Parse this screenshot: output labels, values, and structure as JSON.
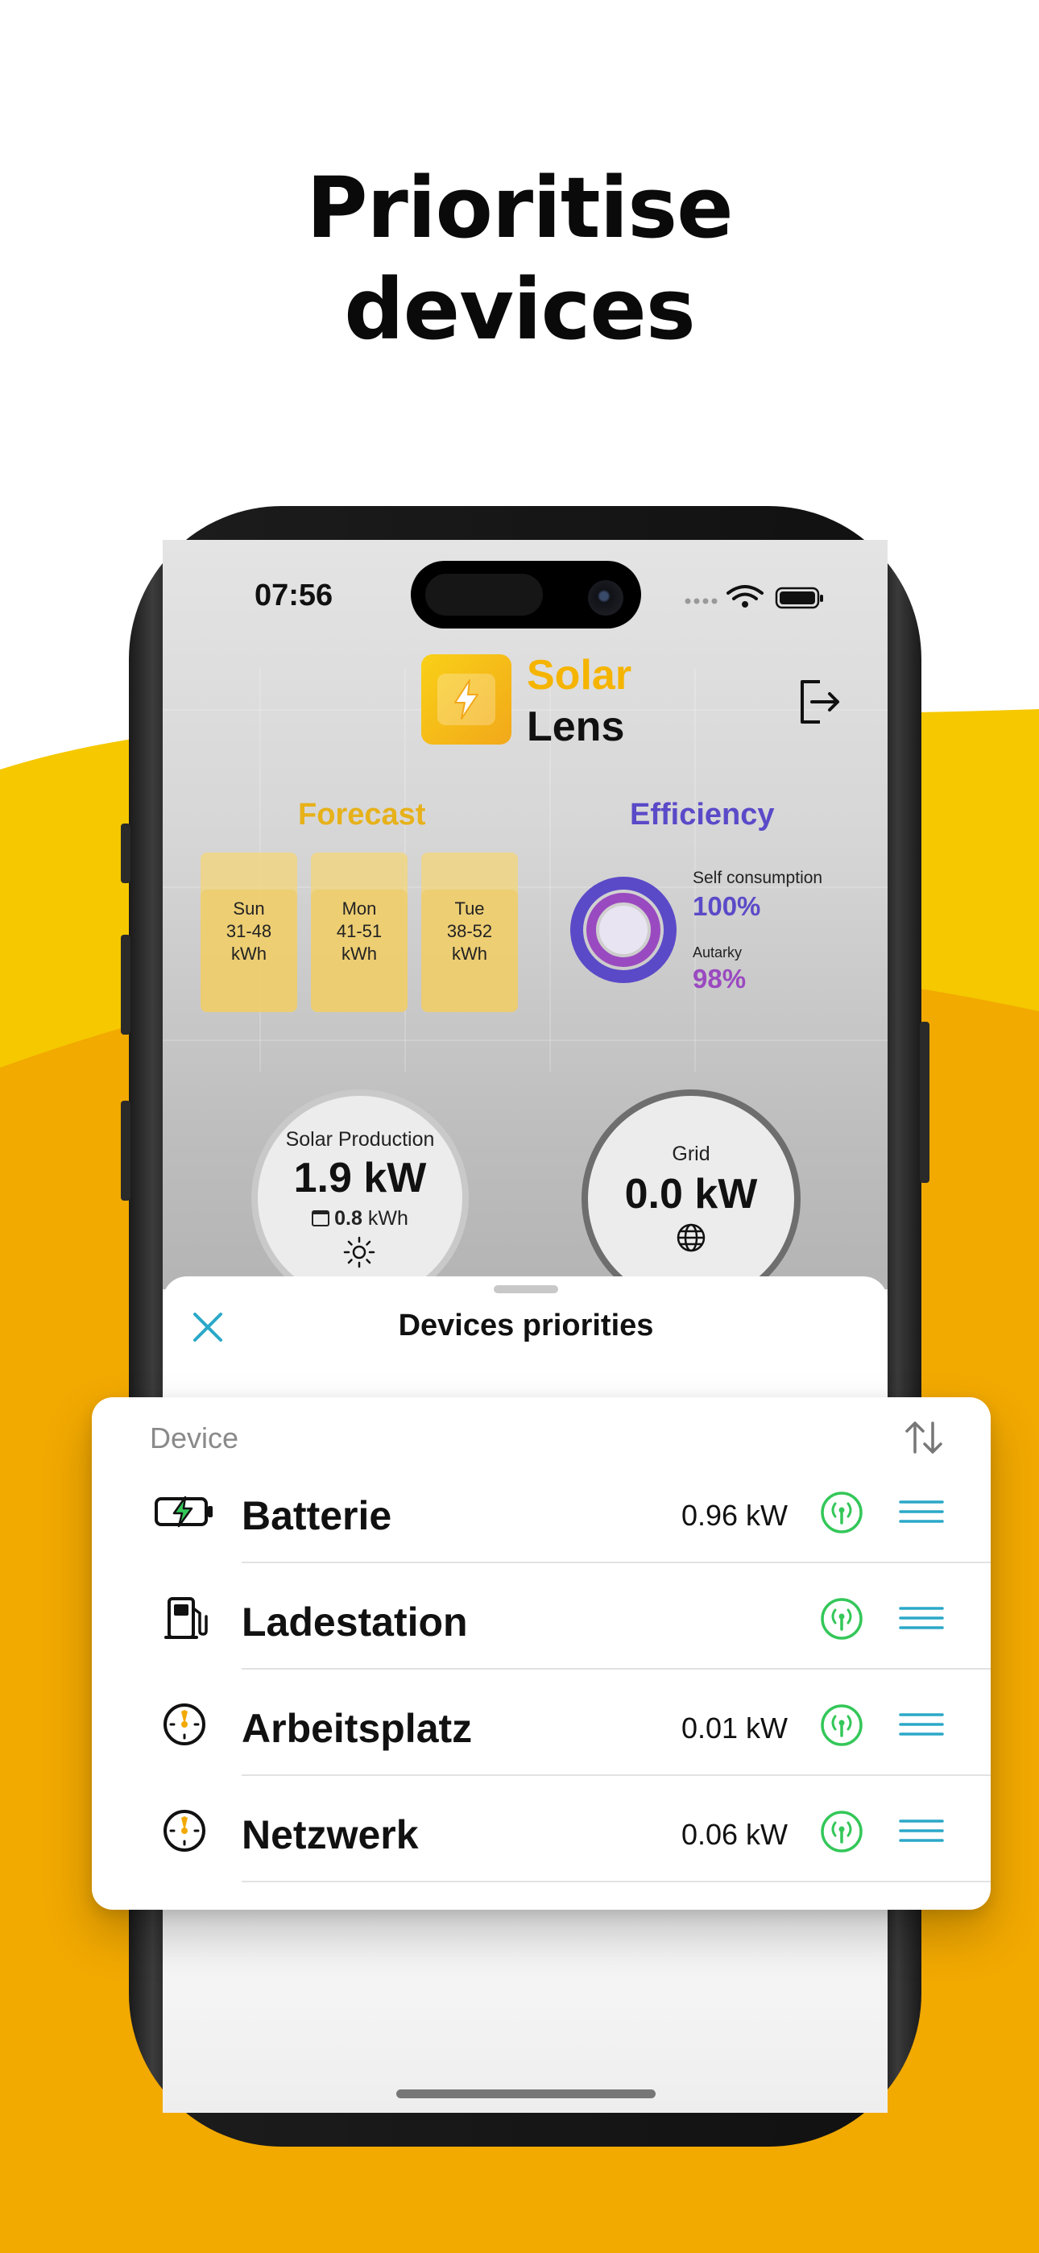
{
  "headline": {
    "line1": "Prioritise",
    "line2": "devices"
  },
  "colors": {
    "accent_yellow": "#F5C400",
    "accent_orange": "#F2A900",
    "green": "#34C759",
    "teal": "#2BA8C8",
    "purple": "#8A4AC8",
    "indigo": "#5A4AC8"
  },
  "status_bar": {
    "time": "07:56"
  },
  "app": {
    "title_line1": "Solar",
    "title_line2": "Lens",
    "logout_icon": "logout-icon"
  },
  "forecast": {
    "title": "Forecast",
    "days": [
      {
        "day": "Sun",
        "range": "31-48",
        "unit": "kWh"
      },
      {
        "day": "Mon",
        "range": "41-51",
        "unit": "kWh"
      },
      {
        "day": "Tue",
        "range": "38-52",
        "unit": "kWh"
      }
    ]
  },
  "efficiency": {
    "title": "Efficiency",
    "self_consumption_label": "Self consumption",
    "self_consumption_value": "100%",
    "autarky_label": "Autarky",
    "autarky_value": "98%"
  },
  "solar": {
    "label": "Solar Production",
    "value": "1.9 kW",
    "energy_value": "0.8",
    "energy_unit": "kWh"
  },
  "grid": {
    "label": "Grid",
    "value": "0.0 kW"
  },
  "sheet": {
    "title": "Devices priorities"
  },
  "table": {
    "column_device": "Device",
    "rows": [
      {
        "name": "Batterie",
        "value": "0.96 kW",
        "icon": "battery-charging-icon"
      },
      {
        "name": "Ladestation",
        "value": "",
        "icon": "charging-station-icon"
      },
      {
        "name": "Arbeitsplatz",
        "value": "0.01 kW",
        "icon": "gauge-icon"
      },
      {
        "name": "Netzwerk",
        "value": "0.06 kW",
        "icon": "gauge-icon"
      }
    ]
  }
}
